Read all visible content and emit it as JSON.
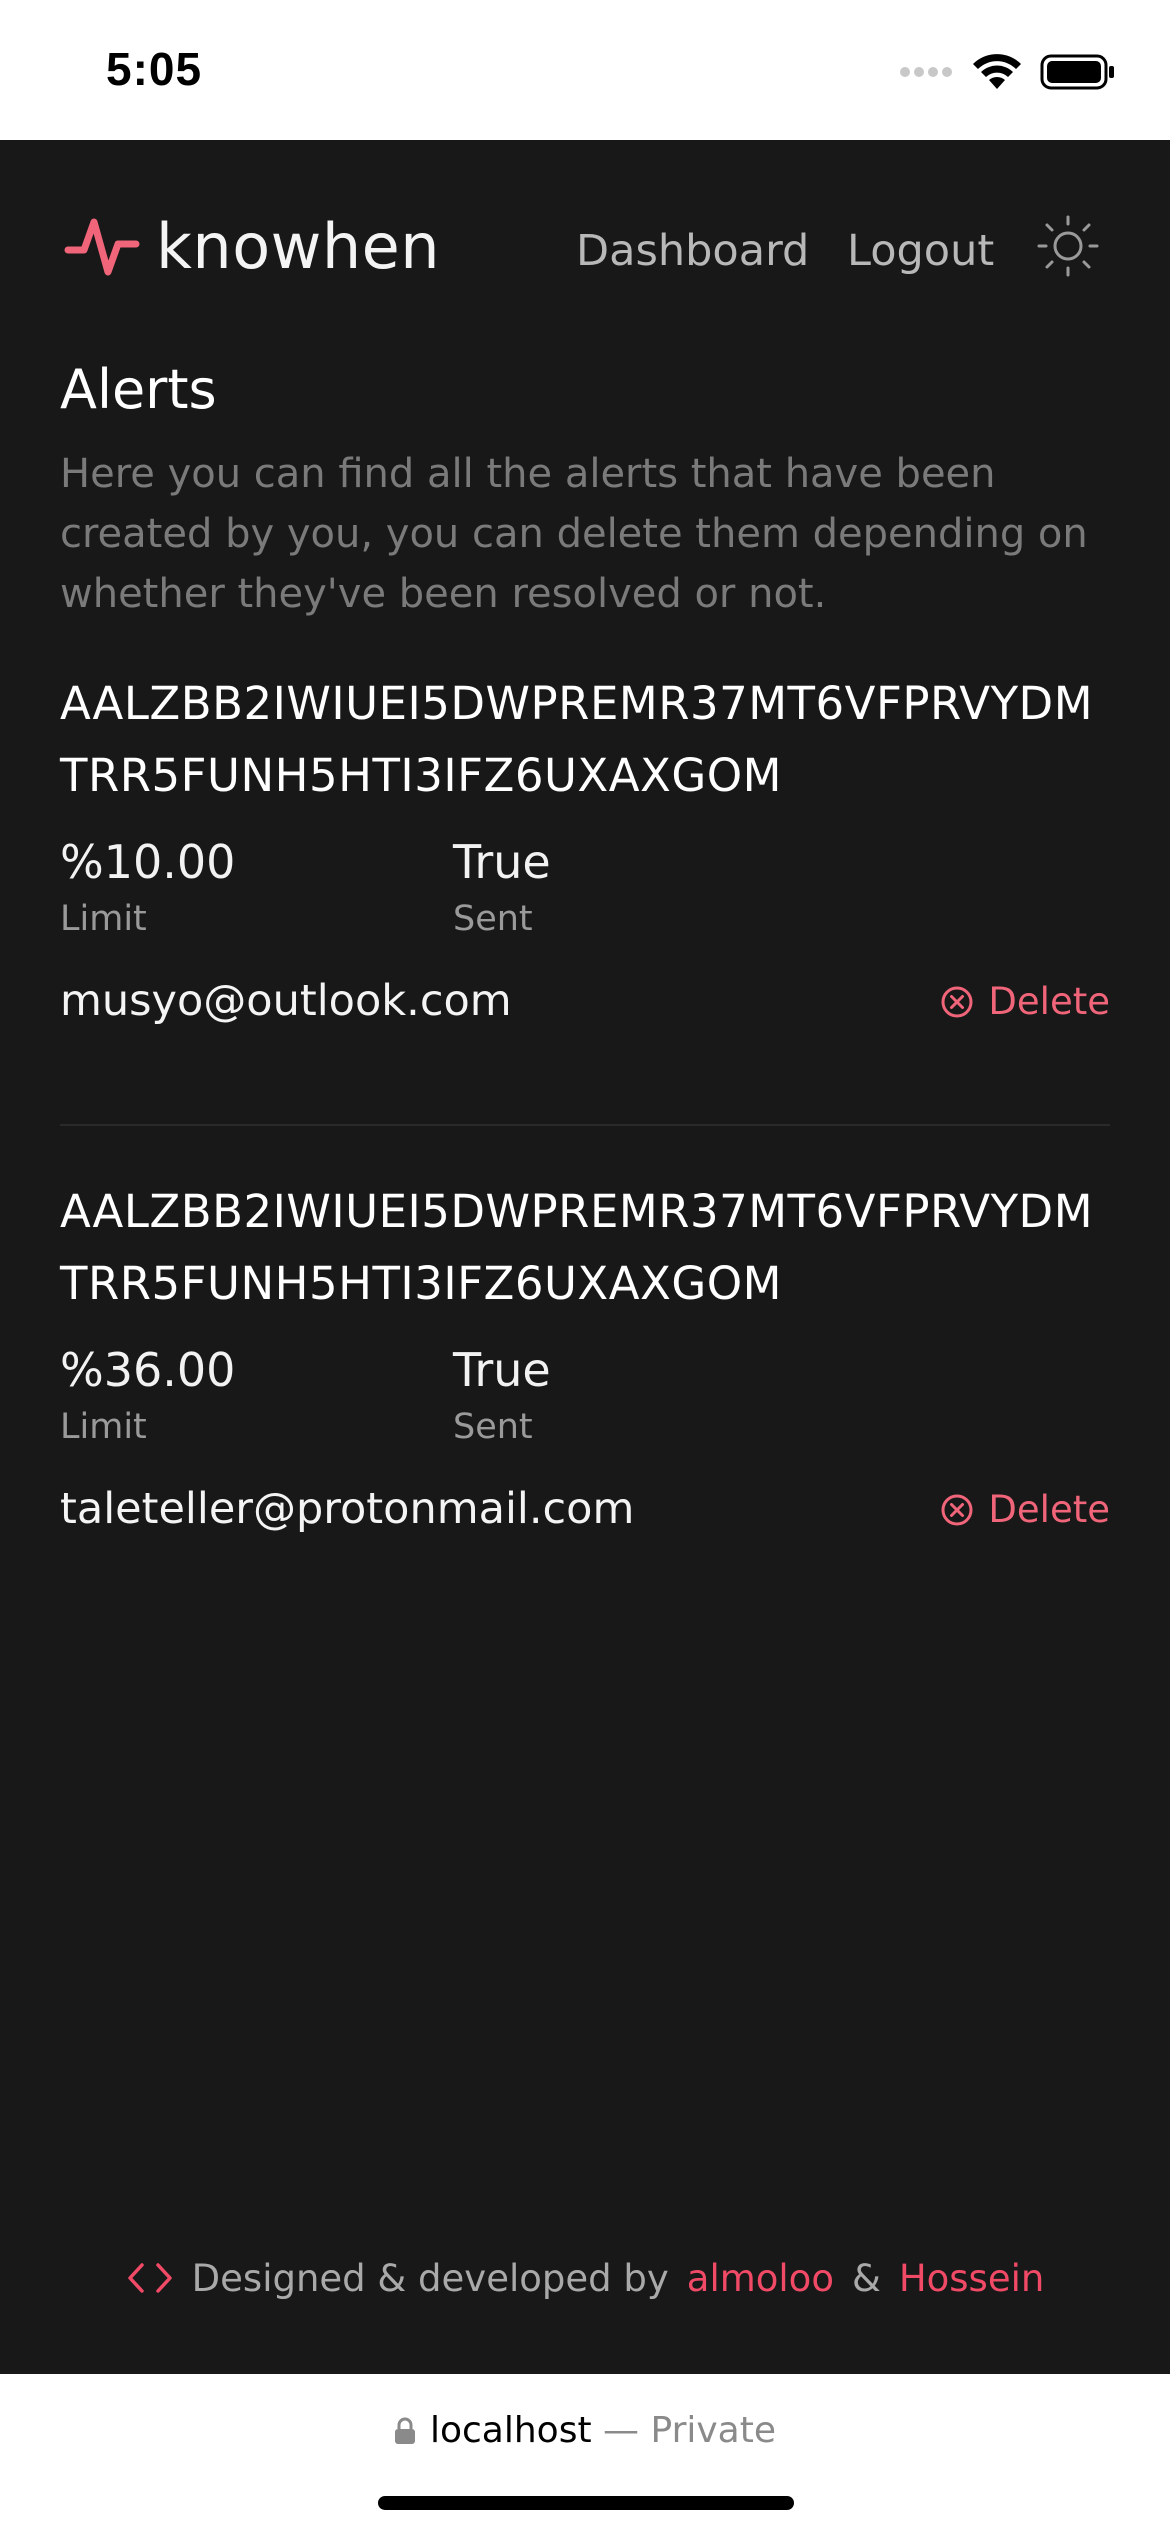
{
  "status_bar": {
    "time": "5:05"
  },
  "app": {
    "brand": "knowhen",
    "accent_color": "#f06579",
    "nav": {
      "dashboard": "Dashboard",
      "logout": "Logout"
    },
    "theme_icon": "sun-icon"
  },
  "page": {
    "title": "Alerts",
    "description": "Here you can find all the alerts that have been created by you, you can delete them depending on whether they've been resolved or not."
  },
  "alerts": [
    {
      "id": "AALZBB2IWIUEI5DWPREMR37MT6VFPRVYDMTRR5FUNH5HTI3IFZ6UXAXGOM",
      "limit_value": "%10.00",
      "limit_label": "Limit",
      "sent_value": "True",
      "sent_label": "Sent",
      "email": "musyo@outlook.com",
      "delete_label": "Delete"
    },
    {
      "id": "AALZBB2IWIUEI5DWPREMR37MT6VFPRVYDMTRR5FUNH5HTI3IFZ6UXAXGOM",
      "limit_value": "%36.00",
      "limit_label": "Limit",
      "sent_value": "True",
      "sent_label": "Sent",
      "email": "taleteller@protonmail.com",
      "delete_label": "Delete"
    }
  ],
  "footer": {
    "text": "Designed & developed by",
    "author1": "almoloo",
    "amp": "&",
    "author2": "Hossein"
  },
  "browser": {
    "host": "localhost",
    "privacy": "— Private"
  }
}
